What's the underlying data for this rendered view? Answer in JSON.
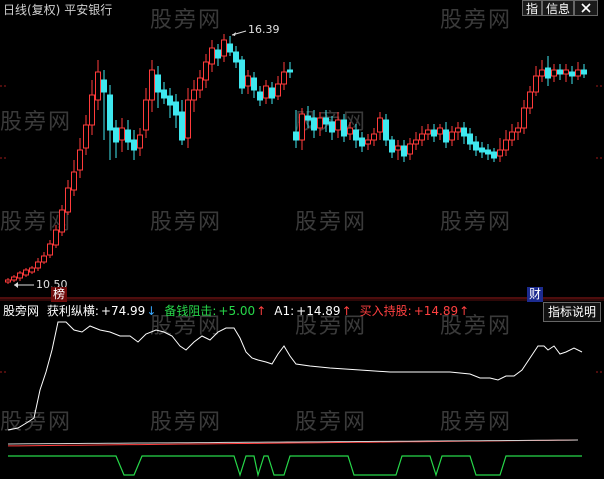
{
  "header": {
    "period": "日线(复权)",
    "stock_name": "平安银行",
    "btn_index": "指",
    "btn_info": "信息",
    "btn_close_icon": "close-icon"
  },
  "price_chart": {
    "high_label": "16.39",
    "low_label": "10.50",
    "tag_left": "榜",
    "tag_right": "财"
  },
  "indicator": {
    "name": "股旁网",
    "items": [
      {
        "label": "获利纵横:",
        "value": "+74.99",
        "arrow": "↓",
        "color": "#ffffff",
        "arrow_color": "#38a8ff"
      },
      {
        "label": "备钱阻击:",
        "value": "+5.00",
        "arrow": "↑",
        "color": "#27d84a",
        "arrow_color": "#ff4040"
      },
      {
        "label": "A1:",
        "value": "+14.89",
        "arrow": "↑",
        "color": "#ffffff",
        "arrow_color": "#ff4040"
      },
      {
        "label": "买入持股:",
        "value": "+14.89",
        "arrow": "↑",
        "color": "#ff4040",
        "arrow_color": "#ff4040"
      }
    ],
    "help_button": "指标说明"
  },
  "watermark": "股旁网",
  "colors": {
    "up": "#ff3b3b",
    "down": "#3fe8ef",
    "axis": "#9b1a1a"
  }
}
